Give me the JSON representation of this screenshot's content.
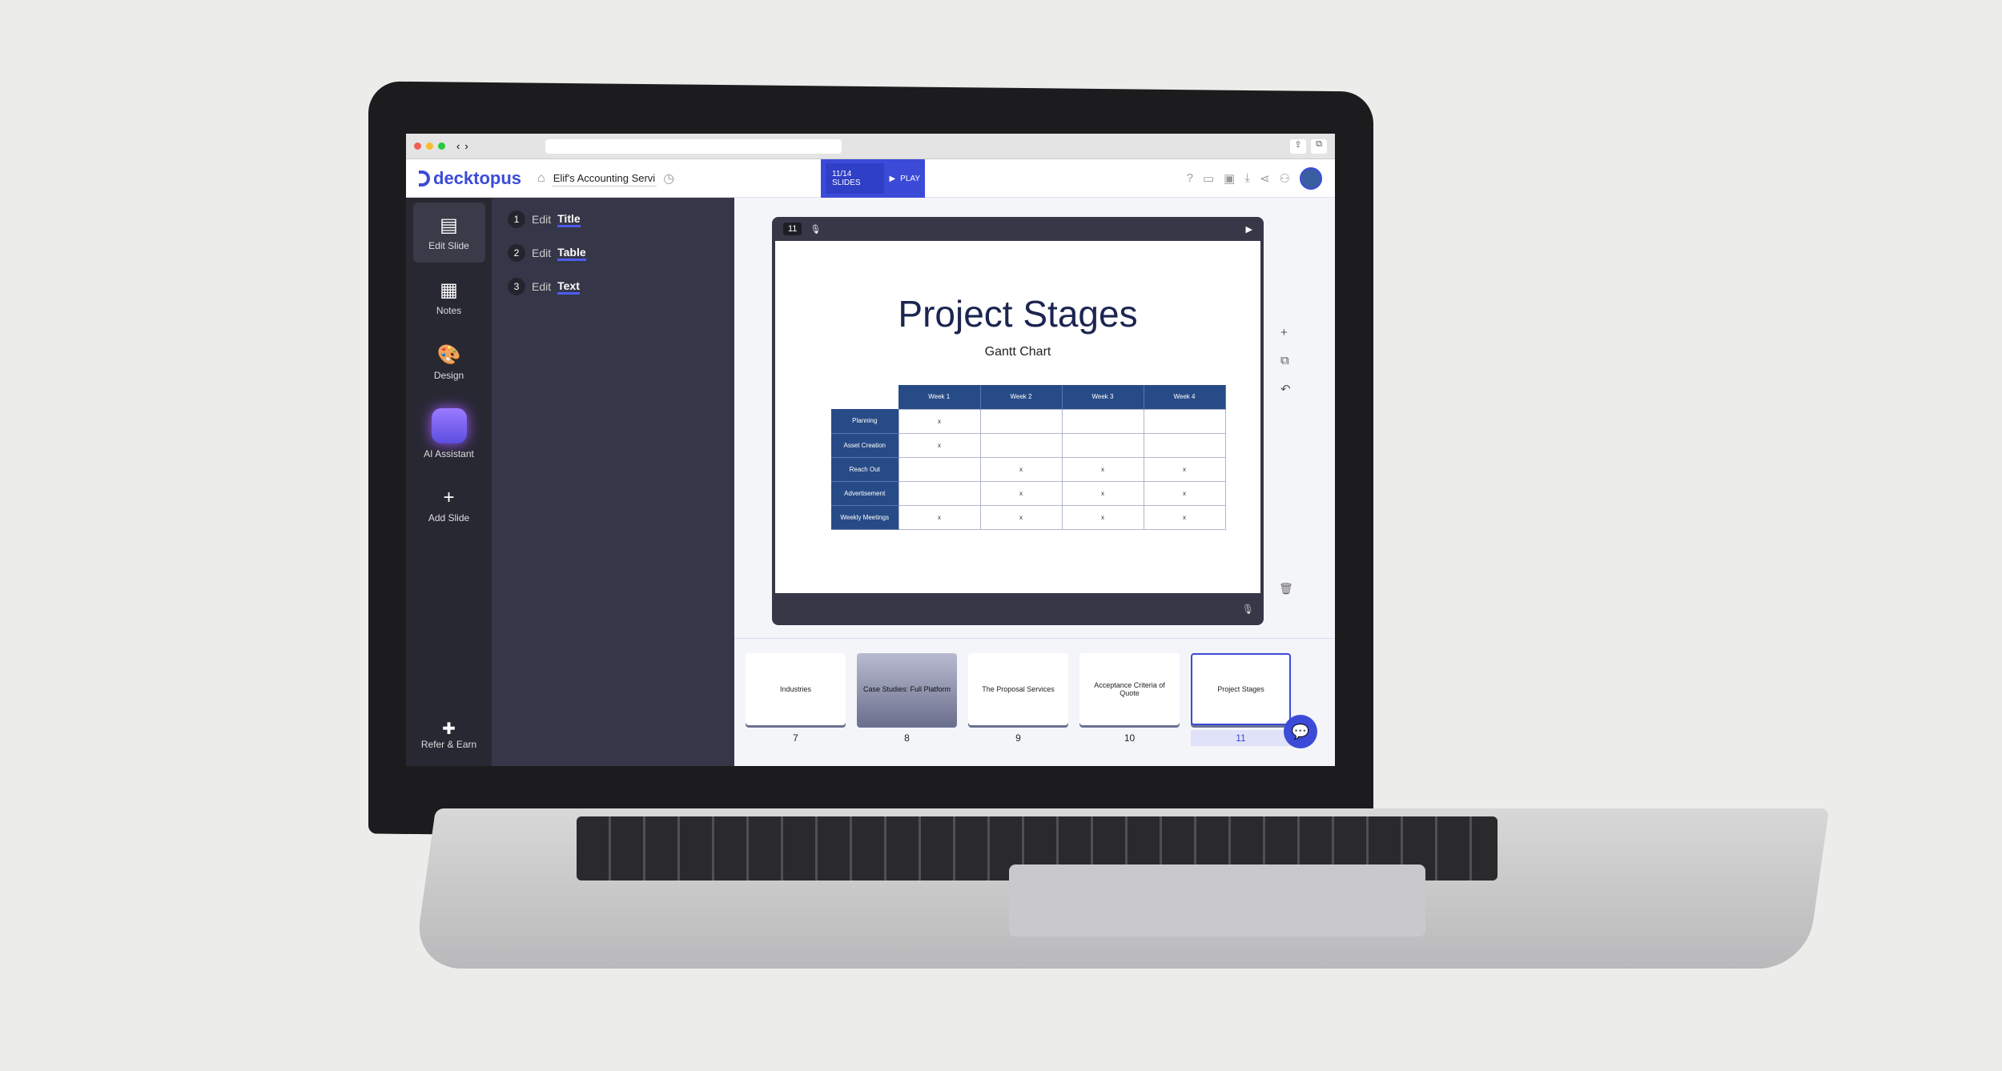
{
  "browser": {
    "controls": [
      "‹",
      "›"
    ]
  },
  "header": {
    "logo": "decktopus",
    "doc_title": "Elif's Accounting Servi",
    "slides_count": "11/14 SLIDES",
    "play": "PLAY",
    "accent": "#3b4bd8"
  },
  "rail": {
    "items": [
      {
        "label": "Edit Slide",
        "icon": "▤"
      },
      {
        "label": "Notes",
        "icon": "▦"
      },
      {
        "label": "Design",
        "icon": "🎨"
      },
      {
        "label": "AI Assistant"
      },
      {
        "label": "Add Slide",
        "icon": "+"
      }
    ],
    "refer": "Refer & Earn"
  },
  "panel": {
    "steps": [
      {
        "n": "1",
        "verb": "Edit",
        "obj": "Title"
      },
      {
        "n": "2",
        "verb": "Edit",
        "obj": "Table"
      },
      {
        "n": "3",
        "verb": "Edit",
        "obj": "Text"
      }
    ]
  },
  "editor": {
    "slide_number": "11",
    "title": "Project Stages",
    "subtitle": "Gantt Chart",
    "table": {
      "columns": [
        "Week 1",
        "Week 2",
        "Week 3",
        "Week 4"
      ],
      "rows": [
        {
          "label": "Planning",
          "cells": [
            "x",
            "",
            "",
            ""
          ]
        },
        {
          "label": "Asset Creation",
          "cells": [
            "x",
            "",
            "",
            ""
          ]
        },
        {
          "label": "Reach Out",
          "cells": [
            "",
            "x",
            "x",
            "x"
          ]
        },
        {
          "label": "Advertisement",
          "cells": [
            "",
            "x",
            "x",
            "x"
          ]
        },
        {
          "label": "Weekly Meetings",
          "cells": [
            "x",
            "x",
            "x",
            "x"
          ]
        }
      ]
    }
  },
  "thumbnails": [
    {
      "n": "7",
      "title": "Industries"
    },
    {
      "n": "8",
      "title": "Case Studies: Full Platform"
    },
    {
      "n": "9",
      "title": "The Proposal Services"
    },
    {
      "n": "10",
      "title": "Acceptance Criteria of Quote"
    },
    {
      "n": "11",
      "title": "Project Stages"
    }
  ]
}
